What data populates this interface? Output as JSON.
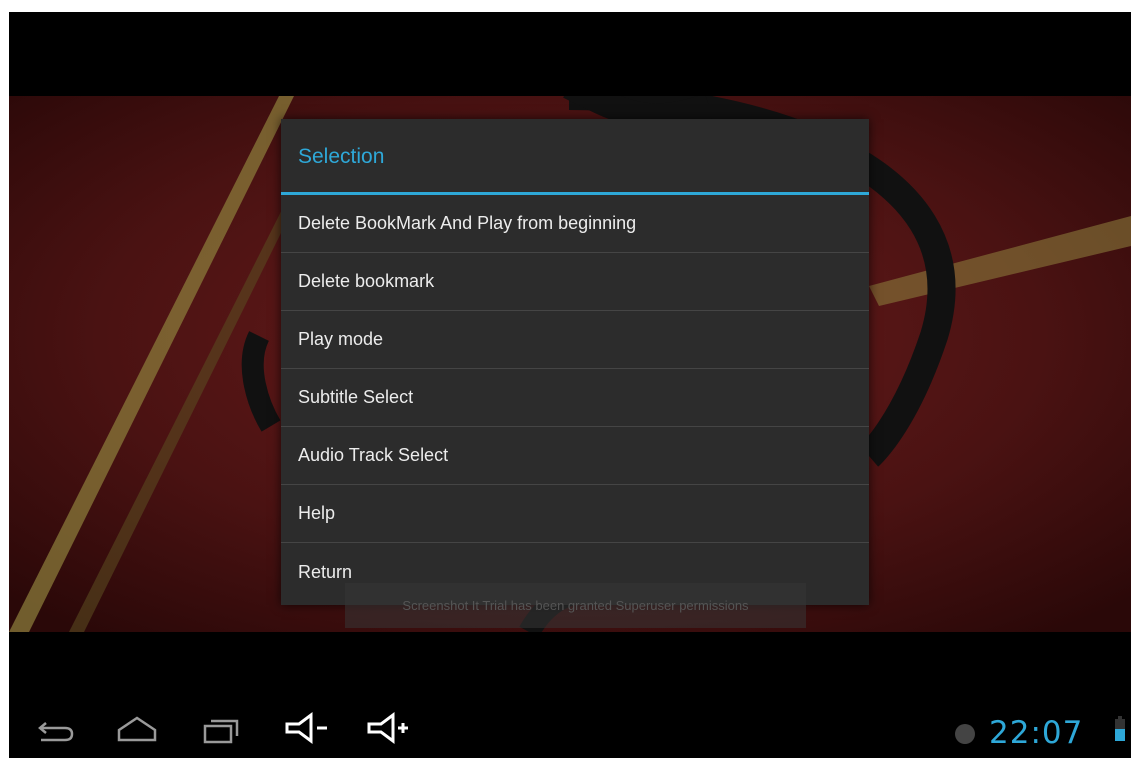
{
  "dialog": {
    "title": "Selection",
    "items": [
      {
        "label": "Delete BookMark And Play from beginning"
      },
      {
        "label": "Delete bookmark"
      },
      {
        "label": "Play mode"
      },
      {
        "label": "Subtitle Select"
      },
      {
        "label": "Audio Track Select"
      },
      {
        "label": "Help"
      },
      {
        "label": "Return"
      }
    ]
  },
  "toast": {
    "text": "Screenshot It Trial has been granted Superuser permissions"
  },
  "nav_bar": {
    "buttons": [
      {
        "icon": "back-icon"
      },
      {
        "icon": "home-icon"
      },
      {
        "icon": "recent-apps-icon"
      },
      {
        "icon": "volume-down-icon"
      },
      {
        "icon": "volume-up-icon"
      }
    ]
  },
  "status": {
    "time": "22:07",
    "battery_icon": "battery-icon",
    "notification_icon": "notification-icon"
  },
  "colors": {
    "accent": "#2ea8d8",
    "dialog_bg": "#2c2c2c",
    "background_red": "#4a1414"
  }
}
